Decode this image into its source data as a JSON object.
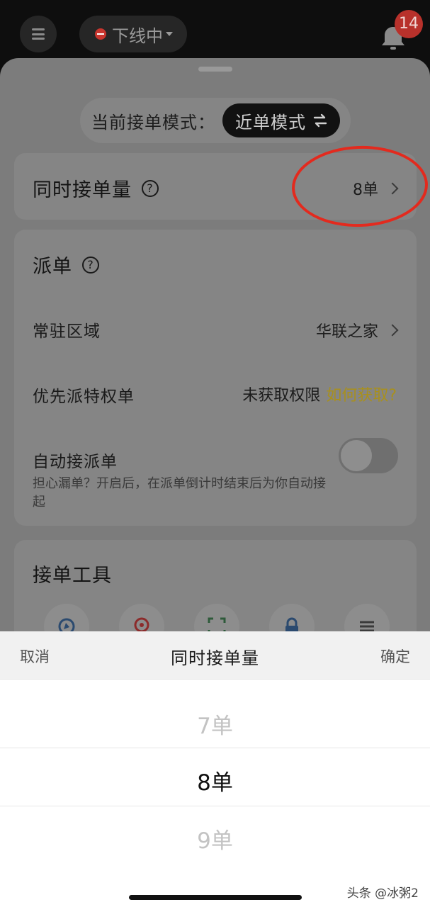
{
  "top_bar": {
    "status_label": "下线中",
    "notification_count": "14",
    "icons": [
      "menu-icon",
      "offline-status-icon",
      "bell-icon"
    ]
  },
  "mode": {
    "label": "当前接单模式：",
    "value": "近单模式",
    "icon": "swap-icon"
  },
  "concurrent": {
    "title": "同时接单量",
    "value": "8单"
  },
  "dispatch": {
    "title": "派单",
    "area_label": "常驻区域",
    "area_value": "华联之家",
    "priority_label": "优先派特权单",
    "priority_value": "未获取权限",
    "priority_link": "如何获取?",
    "auto_label": "自动接派单",
    "auto_hint": "担心漏单？开启后，在派单倒计时结束后为你自动接起",
    "auto_enabled": false
  },
  "tools": {
    "title": "接单工具",
    "icons": [
      "navigation-icon",
      "location-pin-icon",
      "scan-icon",
      "lock-icon",
      "list-icon"
    ]
  },
  "picker": {
    "cancel": "取消",
    "title": "同时接单量",
    "confirm": "确定",
    "options": [
      "7单",
      "8单",
      "9单"
    ],
    "selected": "8单"
  },
  "watermark": "头条 @冰粥2",
  "colors": {
    "annotation_circle": "#e32a1e",
    "gold_link": "#a8901e",
    "badge": "#b8312b"
  }
}
